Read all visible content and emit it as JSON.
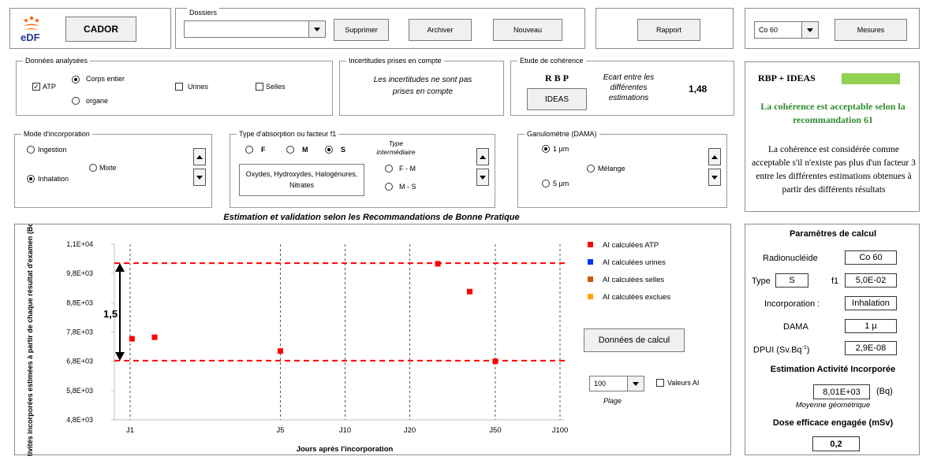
{
  "app": {
    "logo_text": "eDF",
    "title_button": "CADOR"
  },
  "dossiers": {
    "label": "Dossiers",
    "value": "",
    "buttons": [
      "Supprimer",
      "Archiver",
      "Nouveau"
    ]
  },
  "rapport": {
    "label": "Rapport"
  },
  "right_top": {
    "nuclide": "Co 60",
    "mesures": "Mesures"
  },
  "donnees": {
    "title": "Données analysées",
    "atp": "ATP",
    "corps_entier": "Corps entier",
    "organe": "organe",
    "urines": "Urines",
    "selles": "Selles"
  },
  "incertitudes": {
    "title": "Incertitudes prises en compte",
    "text": "Les incertitudes ne sont pas prises en compte"
  },
  "coherence": {
    "title": "Etude  de cohérence",
    "rbp": "R B P",
    "ideas": "IDEAS",
    "ecart_label": "Ecart entre les différentes estimations",
    "ecart_value": "1,48"
  },
  "rbp_panel": {
    "title": "RBP + IDEAS",
    "status_color": "#92d050",
    "result": "La cohérence est acceptable selon la recommandation 61",
    "note": "La cohérence est considérée comme acceptable s'il n'existe pas plus d'un facteur 3 entre les différentes estimations obtenues à partir des différents résultats"
  },
  "mode": {
    "title": "Mode d'incorporation",
    "ingestion": "Ingestion",
    "inhalation": "Inhalation",
    "mixte": "Mixte"
  },
  "absorption": {
    "title": "Type d'absorption  ou facteur f1",
    "f": "F",
    "m": "M",
    "s": "S",
    "type_int": "Type intermédiaire",
    "fm": "F - M",
    "ms": "M - S",
    "compounds": "Oxydes, Hydroxydes, Halogénures, Nitrates"
  },
  "granulo": {
    "title": "Ganulométrie  (DAMA)",
    "one": "1 µm",
    "five": "5 µm",
    "melange": "Mélange"
  },
  "section_title": "Estimation et validation selon les Recommandations de Bonne Pratique",
  "chart_data": {
    "type": "scatter",
    "xlabel": "Jours après l'incorporation",
    "ylabel": "Activités  incorporées  estimées à partir de chaque  résultat  d'examen (Bq)",
    "x_scale": "log",
    "x_ticks": [
      "J1",
      "J5",
      "J10",
      "J20",
      "J50",
      "J100"
    ],
    "x_tick_values": [
      1,
      5,
      10,
      20,
      50,
      100
    ],
    "y_ticks": [
      "4,8E+03",
      "5,8E+03",
      "6,8E+03",
      "7,8E+03",
      "8,8E+03",
      "9,8E+03",
      "1,1E+04"
    ],
    "y_tick_values": [
      4800,
      5800,
      6800,
      7800,
      8800,
      9800,
      10800
    ],
    "ylim": [
      4800,
      10800
    ],
    "grid": "vertical dashed",
    "legend_placement": "right",
    "series": [
      {
        "name": "AI calculées ATP",
        "color": "#ff0000",
        "x": [
          1.02,
          1.3,
          5.0,
          27,
          38,
          50
        ],
        "y": [
          7570,
          7620,
          7150,
          10130,
          9180,
          6800
        ]
      },
      {
        "name": "AI calculées urines",
        "color": "#0033ff",
        "x": [],
        "y": []
      },
      {
        "name": "AI calculées selles",
        "color": "#c65911",
        "x": [],
        "y": []
      },
      {
        "name": "AI calculées exclues",
        "color": "#ffa500",
        "x": [],
        "y": []
      }
    ],
    "hlines": [
      {
        "y": 10150,
        "color": "#ff0000"
      },
      {
        "y": 6820,
        "color": "#ff0000"
      }
    ],
    "ratio_label": "1,5"
  },
  "chart_controls": {
    "donnees_btn": "Données de calcul",
    "plage_value": "100",
    "plage_label": "Plage",
    "valeurs_ai": "Valeurs AI"
  },
  "params": {
    "title": "Paramètres de calcul",
    "radionuclide_label": "Radionucléide",
    "radionuclide": "Co 60",
    "type_label": "Type",
    "type": "S",
    "f1_label": "f1",
    "f1": "5,0E-02",
    "incorporation_label": "Incorporation :",
    "incorporation": "Inhalation",
    "dama_label": "DAMA",
    "dama": "1 µ",
    "dpui_label": "DPUI (Sv.Bq",
    "dpui_sup": "-1",
    "dpui_close": ")",
    "dpui": "2,9E-08",
    "estimation_title": "Estimation Activité Incorporée",
    "activity": "8,01E+03",
    "activity_unit": "(Bq)",
    "activity_note": "Moyenne géométrique",
    "dose_title": "Dose efficace engagée (mSv)",
    "dose": "0,2"
  }
}
